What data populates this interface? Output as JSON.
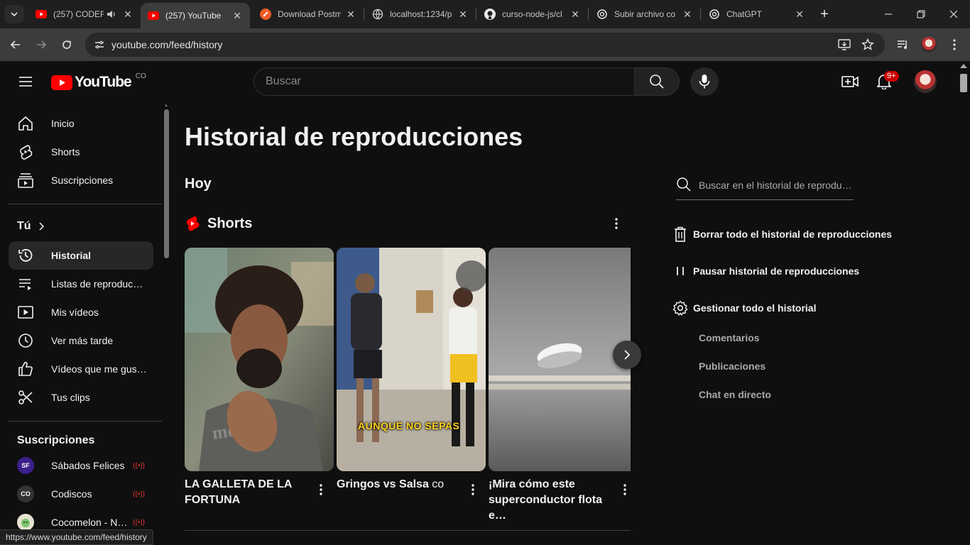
{
  "browser": {
    "tabs": [
      {
        "title": "(257) CODEF",
        "favicon": "youtube-icon",
        "audio": true
      },
      {
        "title": "(257) YouTube",
        "favicon": "youtube-icon",
        "active": true
      },
      {
        "title": "Download Postm",
        "favicon": "postman-icon"
      },
      {
        "title": "localhost:1234/p",
        "favicon": "globe-icon"
      },
      {
        "title": "curso-node-js/cl",
        "favicon": "github-icon"
      },
      {
        "title": "Subir archivo co",
        "favicon": "chatgpt-icon"
      },
      {
        "title": "ChatGPT",
        "favicon": "chatgpt-icon"
      }
    ],
    "url": "youtube.com/feed/history",
    "status_url": "https://www.youtube.com/feed/history"
  },
  "header": {
    "logo_text": "YouTube",
    "country_code": "CO",
    "search_placeholder": "Buscar",
    "notification_count": "9+"
  },
  "sidebar": {
    "main_items": [
      {
        "label": "Inicio",
        "icon": "home-icon"
      },
      {
        "label": "Shorts",
        "icon": "shorts-icon"
      },
      {
        "label": "Suscripciones",
        "icon": "subscriptions-icon"
      }
    ],
    "you_label": "Tú",
    "you_items": [
      {
        "label": "Historial",
        "icon": "history-icon",
        "active": true
      },
      {
        "label": "Listas de reproducción",
        "icon": "playlists-icon"
      },
      {
        "label": "Mis vídeos",
        "icon": "my-videos-icon"
      },
      {
        "label": "Ver más tarde",
        "icon": "watch-later-icon"
      },
      {
        "label": "Vídeos que me gustan",
        "icon": "like-icon"
      },
      {
        "label": "Tus clips",
        "icon": "clips-icon"
      }
    ],
    "subs_label": "Suscripciones",
    "subscriptions": [
      {
        "label": "Sábados Felices",
        "live": true,
        "avatar_text": "SF",
        "color": "#3b1f8a"
      },
      {
        "label": "Codiscos",
        "live": true,
        "avatar_text": "CO",
        "color": "#333333"
      },
      {
        "label": "Cocomelon - Nursery Rhymes",
        "live": true,
        "avatar_text": "",
        "color": "#e8e2d0"
      }
    ]
  },
  "main": {
    "title": "Historial de reproducciones",
    "day": "Hoy",
    "shorts_label": "Shorts",
    "shorts": [
      {
        "title": "LA GALLETA DE LA FORTUNA"
      },
      {
        "title": "Gringos vs Salsa",
        "suffix": "co",
        "caption": "AUNQUE NO SEPAS"
      },
      {
        "title": "¡Mira cómo este superconductor flota e…"
      }
    ]
  },
  "right_panel": {
    "search_placeholder": "Buscar en el historial de reproducciones",
    "clear_all": "Borrar todo el historial de reproducciones",
    "pause": "Pausar historial de reproducciones",
    "manage": "Gestionar todo el historial",
    "sub_items": [
      "Comentarios",
      "Publicaciones",
      "Chat en directo"
    ]
  },
  "colors": {
    "brand_red": "#ff0000",
    "background": "#0f0f0f",
    "active_item": "#272727"
  }
}
